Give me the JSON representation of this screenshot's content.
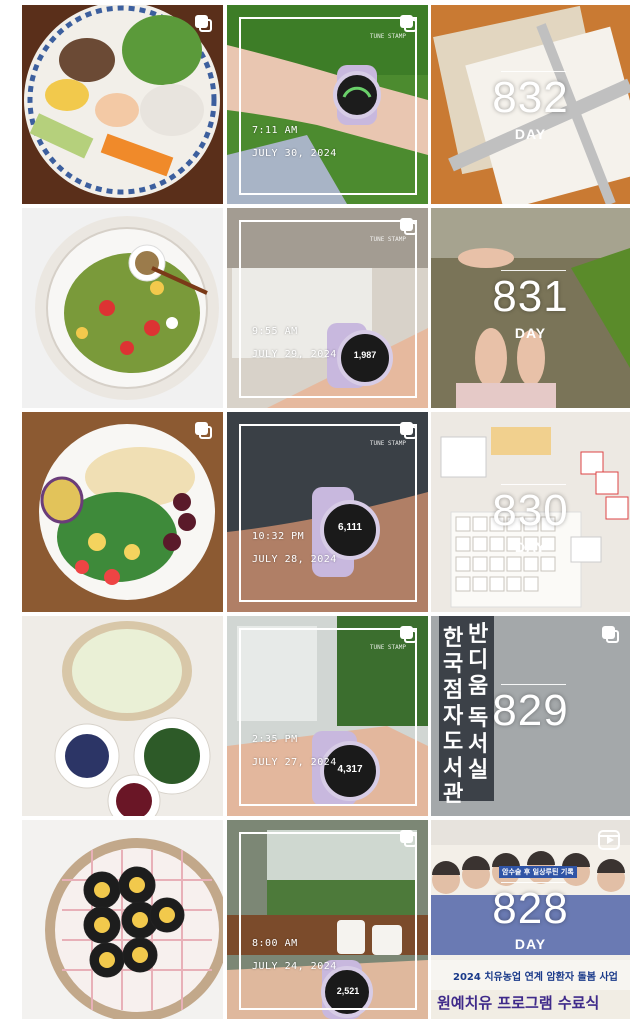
{
  "grid": {
    "posts": [
      {
        "kind": "food",
        "alt": "salad plate with meat, lettuce, pineapple, shrimp, noodles, carrot"
      },
      {
        "kind": "watch",
        "brand": "TUNE STAMP",
        "time": "7:11 AM",
        "date": "JULY 30, 2024",
        "steps": ""
      },
      {
        "kind": "day",
        "day": "832",
        "label": "DAY"
      },
      {
        "kind": "food",
        "alt": "grain bowl salad"
      },
      {
        "kind": "watch",
        "brand": "TUNE STAMP",
        "time": "9:55 AM",
        "date": "JULY 29, 2024",
        "steps": "1,987"
      },
      {
        "kind": "day",
        "day": "831",
        "label": "DAY"
      },
      {
        "kind": "food",
        "alt": "pasta with salad and cherries"
      },
      {
        "kind": "watch",
        "brand": "TUNE STAMP",
        "time": "10:32 PM",
        "date": "JULY 28, 2024",
        "steps": "6,111"
      },
      {
        "kind": "day",
        "day": "830",
        "label": "DAY"
      },
      {
        "kind": "food",
        "alt": "soup with blueberries and greens"
      },
      {
        "kind": "watch",
        "brand": "TUNE STAMP",
        "time": "2:35 PM",
        "date": "JULY 27, 2024",
        "steps": "4,317"
      },
      {
        "kind": "day",
        "day": "829",
        "label": "",
        "sign": [
          "반",
          "디",
          "움",
          "한",
          "국",
          "점",
          "자",
          "도",
          "서",
          "관",
          "독",
          "서",
          "실"
        ]
      },
      {
        "kind": "food",
        "alt": "kimbap on plate"
      },
      {
        "kind": "watch",
        "brand": "",
        "time": "8:00 AM",
        "date": "JULY 24, 2024",
        "steps": "2,521"
      },
      {
        "kind": "day",
        "day": "828",
        "label": "DAY",
        "banner_top": "암수술 후 일상루틴 기록",
        "banner_mid": "2024 치유농업 연계 암환자 돌봄 사업",
        "banner_bottom": "원예치유 프로그램 수료식"
      }
    ]
  },
  "colors": {
    "white": "#ffffff",
    "caption_blue": "#1a3a8a",
    "watch_band": "#c8b8de"
  }
}
